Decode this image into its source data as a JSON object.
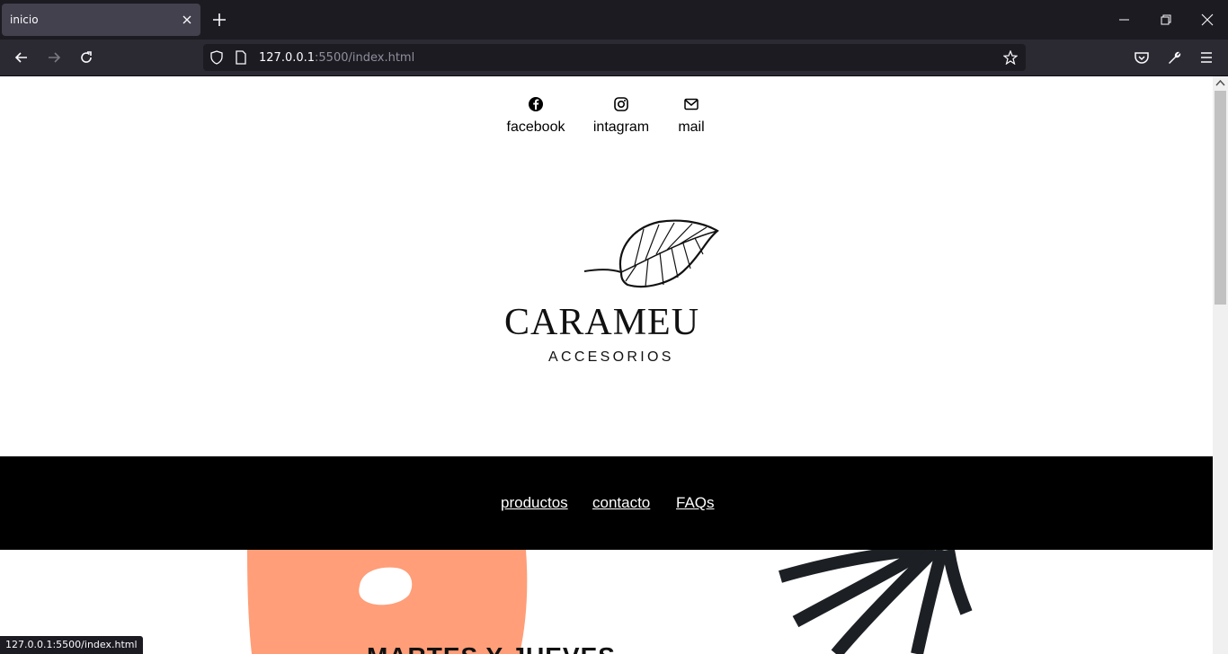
{
  "browser": {
    "tab_title": "inicio",
    "url_host": "127.0.0.1",
    "url_rest": ":5500/index.html",
    "status_url": "127.0.0.1:5500/index.html"
  },
  "social": [
    {
      "label": "facebook",
      "icon": "facebook-icon"
    },
    {
      "label": "intagram",
      "icon": "instagram-icon"
    },
    {
      "label": "mail",
      "icon": "mail-icon"
    }
  ],
  "logo": {
    "brand": "CARAMEU",
    "subtitle": "ACCESORIOS"
  },
  "menu": [
    {
      "label": "productos"
    },
    {
      "label": "contacto"
    },
    {
      "label": "FAQs"
    }
  ],
  "hero": {
    "title": "MARTES Y JUEVES"
  },
  "colors": {
    "menu_bg": "#000000",
    "accent_orange": "#ff9e78",
    "leaf_dark": "#1c2024"
  }
}
